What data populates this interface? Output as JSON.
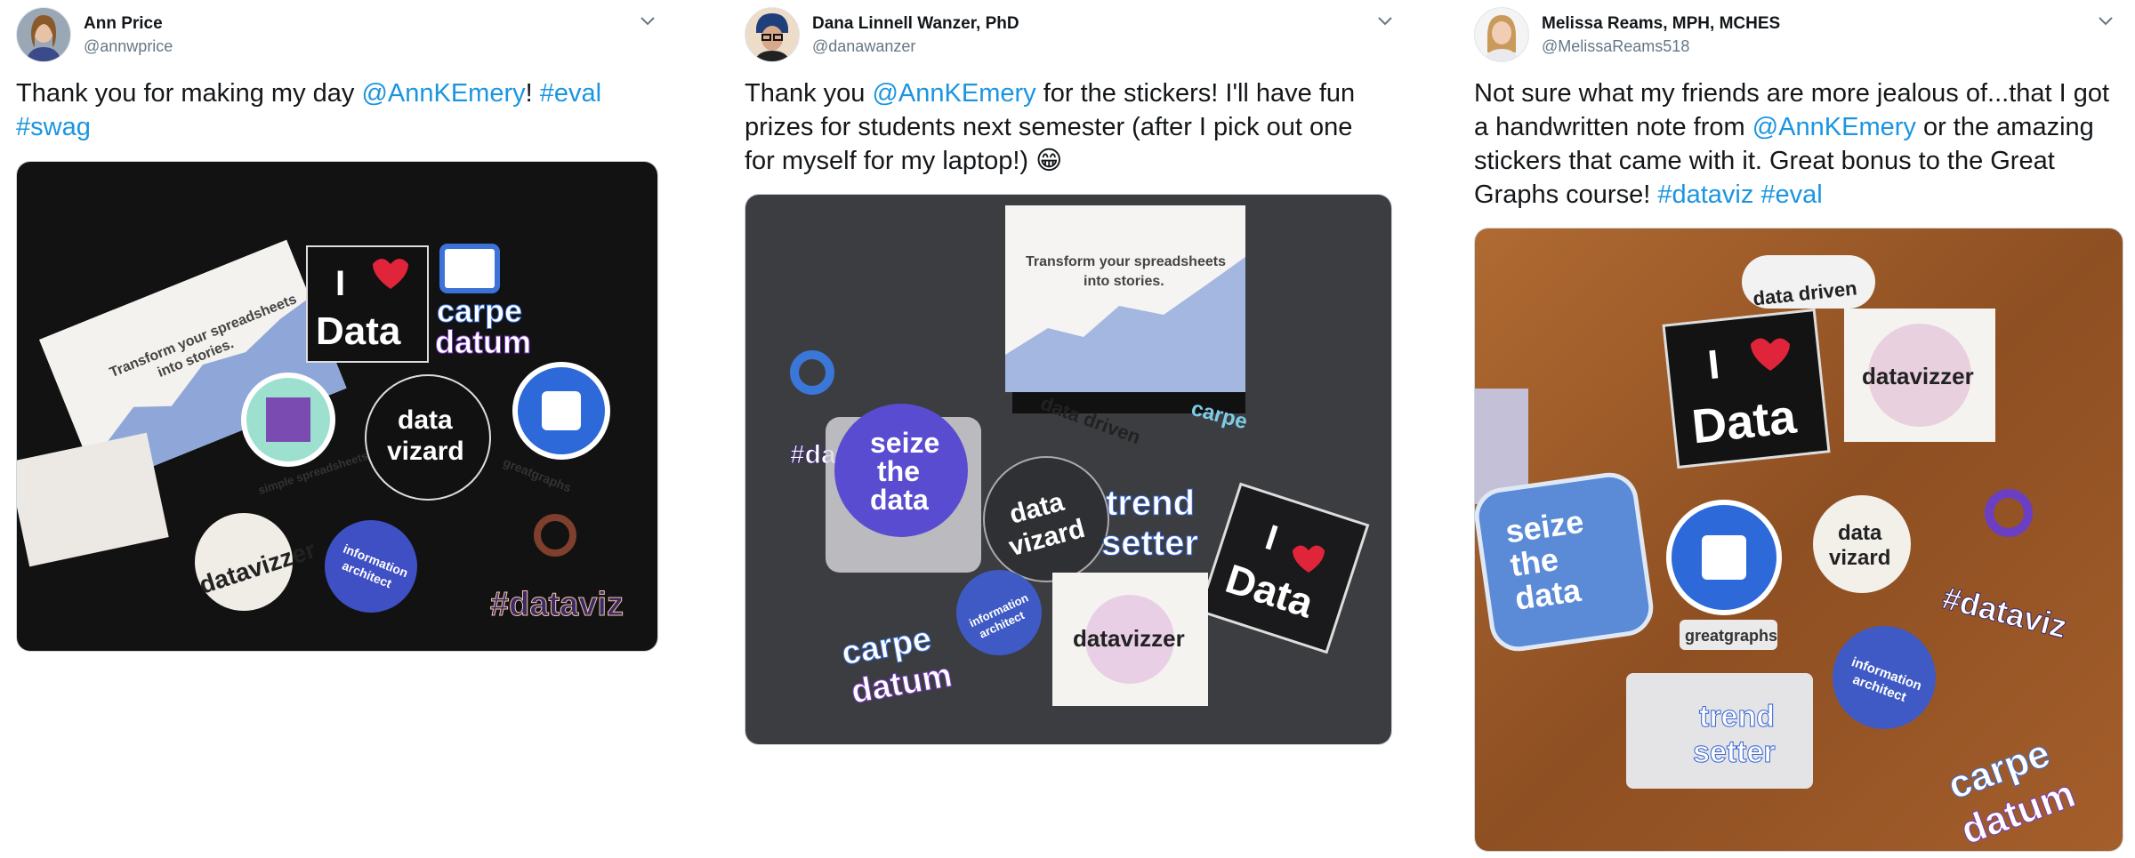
{
  "tweets": [
    {
      "display_name": "Ann Price",
      "handle": "@annwprice",
      "text_lines": [
        [
          {
            "t": "Thank you for making my day "
          },
          {
            "t": "@AnnKEmery",
            "link": true
          },
          {
            "t": "! "
          },
          {
            "t": "#eval",
            "link": true
          }
        ],
        [
          {
            "t": "#swag",
            "link": true
          }
        ]
      ],
      "photo_stickers": {
        "postcard": [
          "Transform your spreadsheets",
          "into stories."
        ],
        "i_love": "I",
        "data": "Data",
        "carpe": "carpe",
        "datum": "datum",
        "data_vizard": [
          "data",
          "vizard"
        ],
        "simple": "simple spreadsheets",
        "greatgraphs": "greatgraphs",
        "datavizzer": "datavizzer",
        "info_arch": [
          "information",
          "architect"
        ],
        "dataviz": "#dataviz"
      }
    },
    {
      "display_name": "Dana Linnell Wanzer, PhD",
      "handle": "@danawanzer",
      "text_lines": [
        [
          {
            "t": "Thank you "
          },
          {
            "t": "@AnnKEmery",
            "link": true
          },
          {
            "t": " for the stickers! I'll have fun"
          }
        ],
        [
          {
            "t": "prizes for students next semester (after I pick out one"
          }
        ],
        [
          {
            "t": "for myself for my laptop!) 😁"
          }
        ]
      ],
      "photo_stickers": {
        "card": [
          "Transform your spreadsheets",
          "into stories."
        ],
        "dataviz": "#dataviz",
        "seize": [
          "seize",
          "the",
          "data"
        ],
        "data_driven": "data driven",
        "carpe": "carpe",
        "datum": "datum",
        "data_vizard": [
          "data",
          "vizard"
        ],
        "trend": [
          "trend",
          "setter"
        ],
        "i_love": "I",
        "data": "Data",
        "info_arch": [
          "information",
          "architect"
        ],
        "datavizzer": "datavizzer"
      }
    },
    {
      "display_name": "Melissa Reams, MPH, MCHES",
      "handle": "@MelissaReams518",
      "text_lines": [
        [
          {
            "t": "Not sure what my friends are more jealous of...that I got"
          }
        ],
        [
          {
            "t": "a handwritten note from "
          },
          {
            "t": "@AnnKEmery",
            "link": true
          },
          {
            "t": " or the amazing"
          }
        ],
        [
          {
            "t": "stickers that came with it. Great bonus to the Great"
          }
        ],
        [
          {
            "t": "Graphs course! "
          },
          {
            "t": "#dataviz",
            "link": true
          },
          {
            "t": " "
          },
          {
            "t": "#eval",
            "link": true
          }
        ]
      ],
      "photo_stickers": {
        "data_driven": "data driven",
        "i_love": "I",
        "data": "Data",
        "datavizzer": "datavizzer",
        "seize": [
          "seize",
          "the",
          "data"
        ],
        "greatgraphs": "greatgraphs",
        "data_vizard": [
          "data",
          "vizard"
        ],
        "dataviz": "#dataviz",
        "info_arch": [
          "information",
          "architect"
        ],
        "trend": [
          "trend",
          "setter"
        ],
        "carpe": "carpe",
        "datum": "datum"
      }
    }
  ],
  "colors": {
    "link": "#1b95e0",
    "text": "#14171a",
    "handle": "#657786"
  }
}
